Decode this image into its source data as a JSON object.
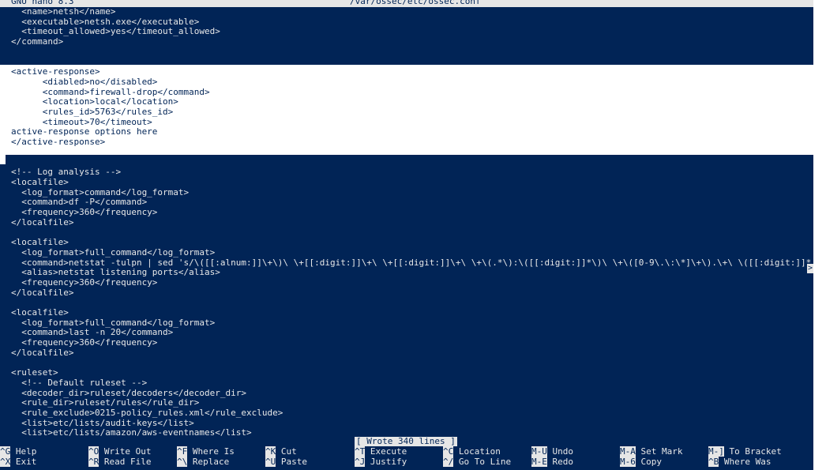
{
  "title": {
    "app": "GNU nano 8.3",
    "file": "/var/ossec/etc/ossec.conf"
  },
  "lines": [
    "  <name>netsh</name>",
    "  <executable>netsh.exe</executable>",
    "  <timeout_allowed>yes</timeout_allowed>",
    "</command>",
    "",
    "",
    "<active-response>",
    "      <diabled>no</disabled>",
    "      <command>firewall-drop</command>",
    "      <location>local</location>",
    "      <rules_id>5763</rules_id>",
    "      <timeout>70</timeout>",
    "active-response options here",
    "</active-response>",
    "",
    "",
    "<!-- Log analysis -->",
    "<localfile>",
    "  <log_format>command</log_format>",
    "  <command>df -P</command>",
    "  <frequency>360</frequency>",
    "</localfile>",
    "",
    "<localfile>",
    "  <log_format>full_command</log_format>",
    "  <command>netstat -tulpn | sed 's/\\([[:alnum:]]\\+\\)\\ \\+[[:digit:]]\\+\\ \\+[[:digit:]]\\+\\ \\+\\(.*\\):\\([[:digit:]]*\\)\\ \\+\\([0-9\\.\\:\\*]\\+\\).\\+\\ \\([[:digit:]]*",
    "  <alias>netstat listening ports</alias>",
    "  <frequency>360</frequency>",
    "</localfile>",
    "",
    "<localfile>",
    "  <log_format>full_command</log_format>",
    "  <command>last -n 20</command>",
    "  <frequency>360</frequency>",
    "</localfile>",
    "",
    "<ruleset>",
    "  <!-- Default ruleset -->",
    "  <decoder_dir>ruleset/decoders</decoder_dir>",
    "  <rule_dir>ruleset/rules</rule_dir>",
    "  <rule_exclude>0215-policy_rules.xml</rule_exclude>",
    "  <list>etc/lists/audit-keys</list>",
    "  <list>etc/lists/amazon/aws-eventnames</list>"
  ],
  "overflow_marker": ">",
  "status_message": "[ Wrote 340 lines ]",
  "shortcuts": [
    [
      {
        "key": "^G",
        "label": "Help"
      },
      {
        "key": "^X",
        "label": "Exit"
      }
    ],
    [
      {
        "key": "^O",
        "label": "Write Out"
      },
      {
        "key": "^R",
        "label": "Read File"
      }
    ],
    [
      {
        "key": "^F",
        "label": "Where Is"
      },
      {
        "key": "^\\",
        "label": "Replace"
      }
    ],
    [
      {
        "key": "^K",
        "label": "Cut"
      },
      {
        "key": "^U",
        "label": "Paste"
      }
    ],
    [
      {
        "key": "^T",
        "label": "Execute"
      },
      {
        "key": "^J",
        "label": "Justify"
      }
    ],
    [
      {
        "key": "^C",
        "label": "Location"
      },
      {
        "key": "^/",
        "label": "Go To Line"
      }
    ],
    [
      {
        "key": "M-U",
        "label": "Undo"
      },
      {
        "key": "M-E",
        "label": "Redo"
      }
    ],
    [
      {
        "key": "M-A",
        "label": "Set Mark"
      },
      {
        "key": "M-6",
        "label": "Copy"
      }
    ],
    [
      {
        "key": "M-]",
        "label": "To Bracket"
      },
      {
        "key": "^B",
        "label": "Where Was"
      }
    ]
  ],
  "colors": {
    "background": "#012456",
    "foreground": "#e8e8e8",
    "inverse_bg": "#e6e6e6",
    "selection_bg": "#ffffff"
  }
}
